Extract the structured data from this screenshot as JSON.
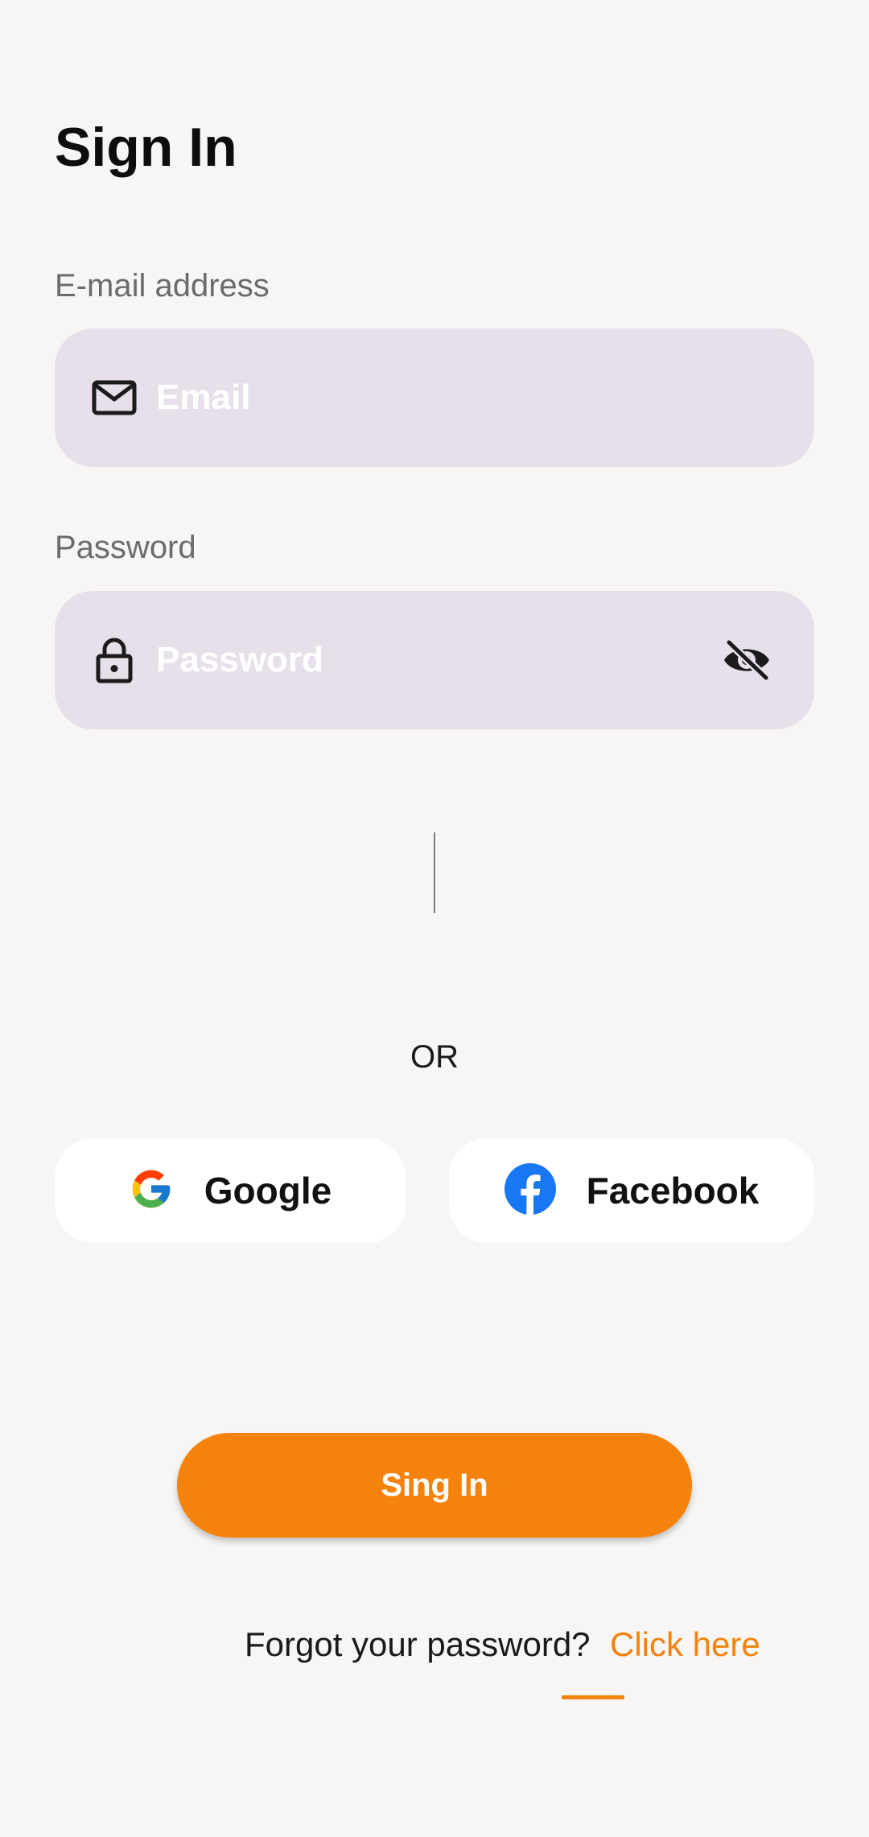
{
  "header": {
    "title": "Sign In"
  },
  "email": {
    "label": "E-mail address",
    "placeholder": "Email",
    "value": "",
    "icon": "mail-icon"
  },
  "password": {
    "label": "Password",
    "placeholder": "Password",
    "value": "",
    "icon": "lock-icon",
    "toggle_icon": "eye-off-icon"
  },
  "divider": {
    "text": "OR"
  },
  "social": {
    "google_label": "Google",
    "facebook_label": "Facebook"
  },
  "actions": {
    "signin_label": "Sing In",
    "forgot_text": "Forgot your password?",
    "forgot_link": "Click here"
  },
  "colors": {
    "accent": "#f5820b",
    "field_background": "#e7dfea",
    "page_background": "#f7f6f4",
    "facebook_blue": "#1877f2"
  }
}
